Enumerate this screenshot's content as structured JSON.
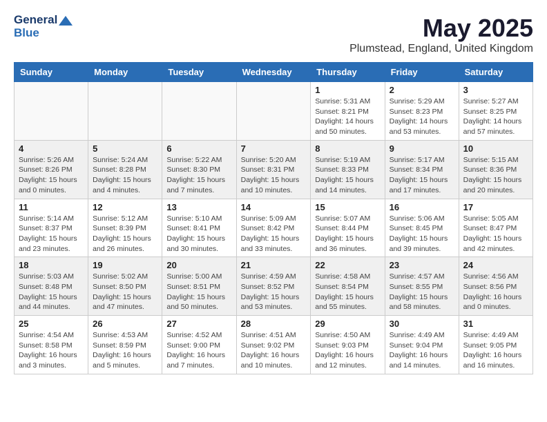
{
  "header": {
    "logo_line1": "General",
    "logo_line2": "Blue",
    "month_title": "May 2025",
    "location": "Plumstead, England, United Kingdom"
  },
  "days_of_week": [
    "Sunday",
    "Monday",
    "Tuesday",
    "Wednesday",
    "Thursday",
    "Friday",
    "Saturday"
  ],
  "weeks": [
    [
      {
        "day": "",
        "info": ""
      },
      {
        "day": "",
        "info": ""
      },
      {
        "day": "",
        "info": ""
      },
      {
        "day": "",
        "info": ""
      },
      {
        "day": "1",
        "info": "Sunrise: 5:31 AM\nSunset: 8:21 PM\nDaylight: 14 hours\nand 50 minutes."
      },
      {
        "day": "2",
        "info": "Sunrise: 5:29 AM\nSunset: 8:23 PM\nDaylight: 14 hours\nand 53 minutes."
      },
      {
        "day": "3",
        "info": "Sunrise: 5:27 AM\nSunset: 8:25 PM\nDaylight: 14 hours\nand 57 minutes."
      }
    ],
    [
      {
        "day": "4",
        "info": "Sunrise: 5:26 AM\nSunset: 8:26 PM\nDaylight: 15 hours\nand 0 minutes."
      },
      {
        "day": "5",
        "info": "Sunrise: 5:24 AM\nSunset: 8:28 PM\nDaylight: 15 hours\nand 4 minutes."
      },
      {
        "day": "6",
        "info": "Sunrise: 5:22 AM\nSunset: 8:30 PM\nDaylight: 15 hours\nand 7 minutes."
      },
      {
        "day": "7",
        "info": "Sunrise: 5:20 AM\nSunset: 8:31 PM\nDaylight: 15 hours\nand 10 minutes."
      },
      {
        "day": "8",
        "info": "Sunrise: 5:19 AM\nSunset: 8:33 PM\nDaylight: 15 hours\nand 14 minutes."
      },
      {
        "day": "9",
        "info": "Sunrise: 5:17 AM\nSunset: 8:34 PM\nDaylight: 15 hours\nand 17 minutes."
      },
      {
        "day": "10",
        "info": "Sunrise: 5:15 AM\nSunset: 8:36 PM\nDaylight: 15 hours\nand 20 minutes."
      }
    ],
    [
      {
        "day": "11",
        "info": "Sunrise: 5:14 AM\nSunset: 8:37 PM\nDaylight: 15 hours\nand 23 minutes."
      },
      {
        "day": "12",
        "info": "Sunrise: 5:12 AM\nSunset: 8:39 PM\nDaylight: 15 hours\nand 26 minutes."
      },
      {
        "day": "13",
        "info": "Sunrise: 5:10 AM\nSunset: 8:41 PM\nDaylight: 15 hours\nand 30 minutes."
      },
      {
        "day": "14",
        "info": "Sunrise: 5:09 AM\nSunset: 8:42 PM\nDaylight: 15 hours\nand 33 minutes."
      },
      {
        "day": "15",
        "info": "Sunrise: 5:07 AM\nSunset: 8:44 PM\nDaylight: 15 hours\nand 36 minutes."
      },
      {
        "day": "16",
        "info": "Sunrise: 5:06 AM\nSunset: 8:45 PM\nDaylight: 15 hours\nand 39 minutes."
      },
      {
        "day": "17",
        "info": "Sunrise: 5:05 AM\nSunset: 8:47 PM\nDaylight: 15 hours\nand 42 minutes."
      }
    ],
    [
      {
        "day": "18",
        "info": "Sunrise: 5:03 AM\nSunset: 8:48 PM\nDaylight: 15 hours\nand 44 minutes."
      },
      {
        "day": "19",
        "info": "Sunrise: 5:02 AM\nSunset: 8:50 PM\nDaylight: 15 hours\nand 47 minutes."
      },
      {
        "day": "20",
        "info": "Sunrise: 5:00 AM\nSunset: 8:51 PM\nDaylight: 15 hours\nand 50 minutes."
      },
      {
        "day": "21",
        "info": "Sunrise: 4:59 AM\nSunset: 8:52 PM\nDaylight: 15 hours\nand 53 minutes."
      },
      {
        "day": "22",
        "info": "Sunrise: 4:58 AM\nSunset: 8:54 PM\nDaylight: 15 hours\nand 55 minutes."
      },
      {
        "day": "23",
        "info": "Sunrise: 4:57 AM\nSunset: 8:55 PM\nDaylight: 15 hours\nand 58 minutes."
      },
      {
        "day": "24",
        "info": "Sunrise: 4:56 AM\nSunset: 8:56 PM\nDaylight: 16 hours\nand 0 minutes."
      }
    ],
    [
      {
        "day": "25",
        "info": "Sunrise: 4:54 AM\nSunset: 8:58 PM\nDaylight: 16 hours\nand 3 minutes."
      },
      {
        "day": "26",
        "info": "Sunrise: 4:53 AM\nSunset: 8:59 PM\nDaylight: 16 hours\nand 5 minutes."
      },
      {
        "day": "27",
        "info": "Sunrise: 4:52 AM\nSunset: 9:00 PM\nDaylight: 16 hours\nand 7 minutes."
      },
      {
        "day": "28",
        "info": "Sunrise: 4:51 AM\nSunset: 9:02 PM\nDaylight: 16 hours\nand 10 minutes."
      },
      {
        "day": "29",
        "info": "Sunrise: 4:50 AM\nSunset: 9:03 PM\nDaylight: 16 hours\nand 12 minutes."
      },
      {
        "day": "30",
        "info": "Sunrise: 4:49 AM\nSunset: 9:04 PM\nDaylight: 16 hours\nand 14 minutes."
      },
      {
        "day": "31",
        "info": "Sunrise: 4:49 AM\nSunset: 9:05 PM\nDaylight: 16 hours\nand 16 minutes."
      }
    ]
  ]
}
